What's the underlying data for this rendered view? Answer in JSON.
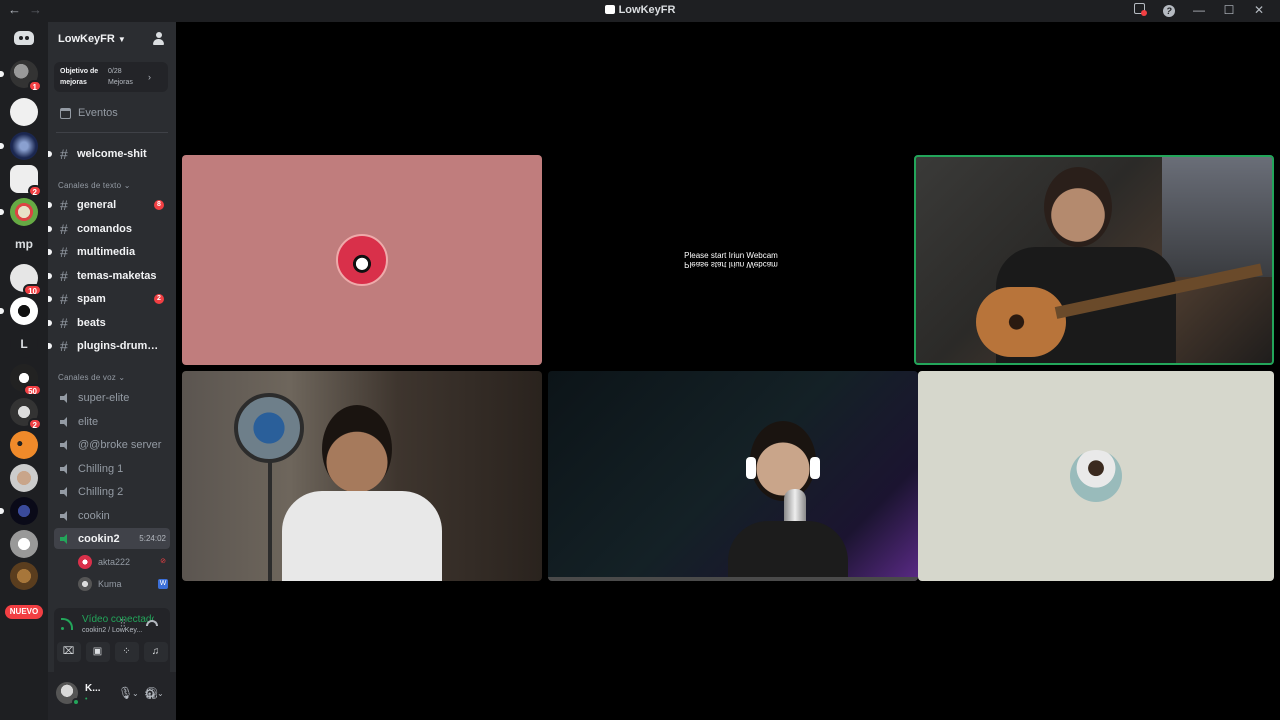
{
  "window": {
    "title": "LowKeyFR",
    "back": "←",
    "forward": "→",
    "minimize": "—",
    "maximize": "☐",
    "close": "✕"
  },
  "rail": {
    "badges": [
      "1",
      "2",
      "10",
      "50",
      "2"
    ],
    "text_servers": [
      "mp",
      "L"
    ],
    "new_label": "NUEVO"
  },
  "guild": {
    "name": "LowKeyFR",
    "boost_title": "Objetivo de mejoras",
    "boost_count": "0/28 Mejoras",
    "events": "Eventos"
  },
  "channels": {
    "top": {
      "name": "welcome-shit"
    },
    "text_category": "Canales de texto",
    "text": [
      {
        "name": "general",
        "badge": "8"
      },
      {
        "name": "comandos",
        "badge": ""
      },
      {
        "name": "multimedia",
        "badge": ""
      },
      {
        "name": "temas-maketas",
        "badge": ""
      },
      {
        "name": "spam",
        "badge": "2"
      },
      {
        "name": "beats",
        "badge": ""
      },
      {
        "name": "plugins-drumkit...",
        "badge": ""
      }
    ],
    "voice_category": "Canales de voz",
    "voice": [
      {
        "name": "super-elite"
      },
      {
        "name": "elite"
      },
      {
        "name": "@@broke server"
      },
      {
        "name": "Chilling 1"
      },
      {
        "name": "Chilling 2"
      },
      {
        "name": "cookin"
      },
      {
        "name": "cookin2",
        "timer": "5:24:02"
      }
    ],
    "members": [
      {
        "name": "akta222"
      },
      {
        "name": "Kuma"
      }
    ]
  },
  "voice_panel": {
    "status": "Vídeo conectado",
    "channel": "cookin2 / LowKey..."
  },
  "user": {
    "name": "K...",
    "sub": "•"
  },
  "stage": {
    "webcam_message": "Please start Iriun Webcam"
  },
  "colors": {
    "accent_green": "#23a55a",
    "badge_red": "#f23f43",
    "rail_bg": "#1e1f22",
    "sidebar_bg": "#2b2d31"
  }
}
